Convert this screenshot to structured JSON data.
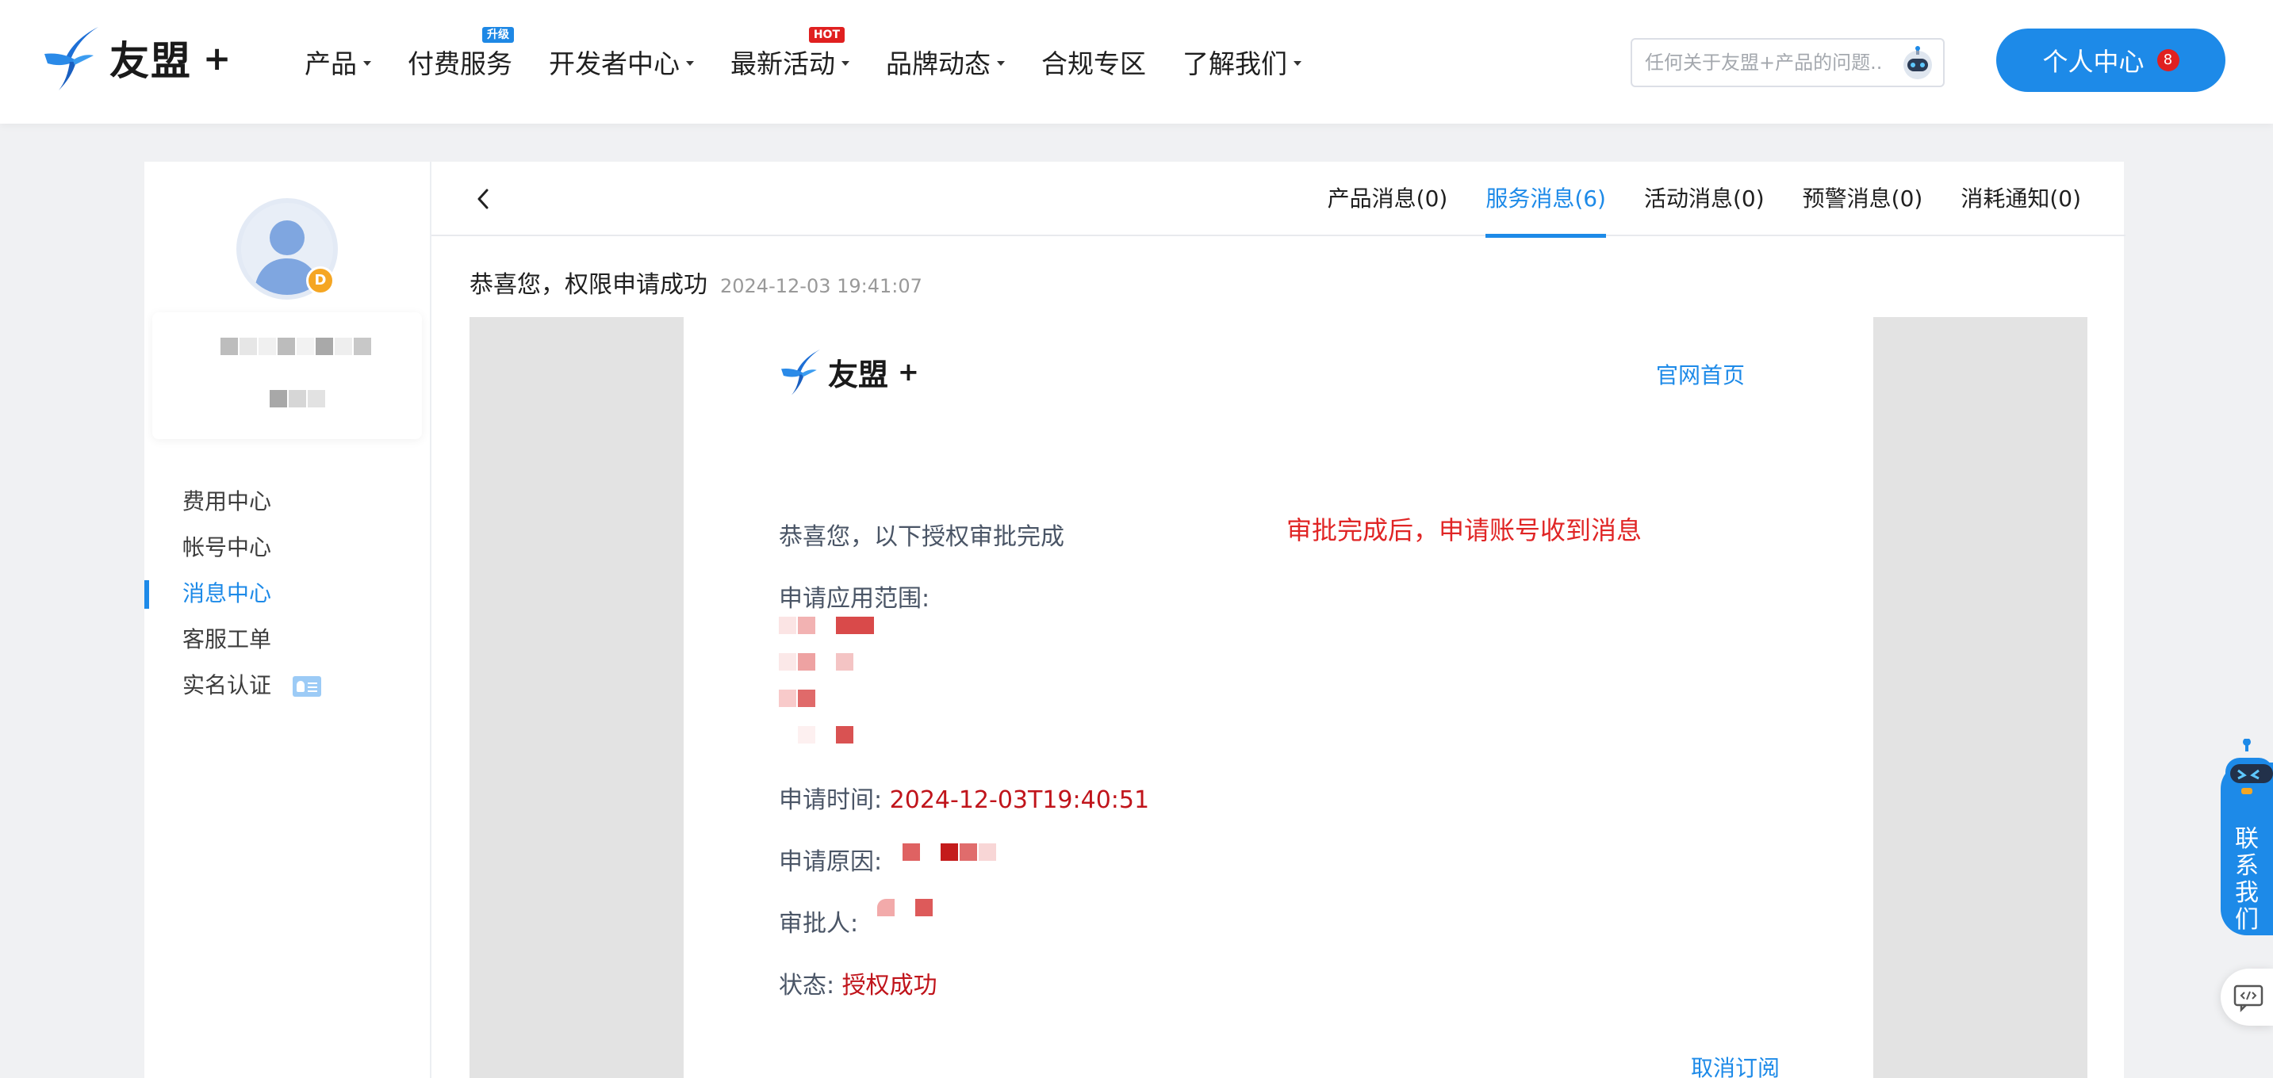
{
  "brand": {
    "name": "友盟",
    "plus": "+"
  },
  "nav": {
    "items": [
      {
        "label": "产品",
        "caret": true,
        "badge": ""
      },
      {
        "label": "付费服务",
        "caret": false,
        "badge": "升级"
      },
      {
        "label": "开发者中心",
        "caret": true,
        "badge": ""
      },
      {
        "label": "最新活动",
        "caret": true,
        "badge": "HOT"
      },
      {
        "label": "品牌动态",
        "caret": true,
        "badge": ""
      },
      {
        "label": "合规专区",
        "caret": false,
        "badge": ""
      },
      {
        "label": "了解我们",
        "caret": true,
        "badge": ""
      }
    ],
    "search_placeholder": "任何关于友盟+产品的问题..",
    "user_center_label": "个人中心",
    "user_center_count": "8"
  },
  "sidebar": {
    "avatar_badge": "D",
    "menu": [
      {
        "label": "费用中心",
        "active": false
      },
      {
        "label": "帐号中心",
        "active": false
      },
      {
        "label": "消息中心",
        "active": true
      },
      {
        "label": "客服工单",
        "active": false
      },
      {
        "label": "实名认证",
        "active": false
      }
    ]
  },
  "main": {
    "tabs": [
      {
        "label": "产品消息(0)",
        "active": false
      },
      {
        "label": "服务消息(6)",
        "active": true
      },
      {
        "label": "活动消息(0)",
        "active": false
      },
      {
        "label": "预警消息(0)",
        "active": false
      },
      {
        "label": "消耗通知(0)",
        "active": false
      }
    ],
    "message_title": "恭喜您，权限申请成功",
    "message_time": "2024-12-03 19:41:07",
    "mail": {
      "home_link": "官网首页",
      "greeting": "恭喜您，以下授权审批完成",
      "annotation": "审批完成后，申请账号收到消息",
      "scope_label": "申请应用范围:",
      "time_label": "申请时间:",
      "time_value": "2024-12-03T19:40:51",
      "reason_label": "申请原因:",
      "approver_label": "审批人:",
      "status_label": "状态:",
      "status_value": "授权成功",
      "unsubscribe": "取消订阅"
    }
  },
  "floating": {
    "contact_label": "联系我们"
  },
  "colors": {
    "accent": "#1d8ae8",
    "highlight_red": "#c0141b",
    "annotation_red": "#e02525"
  }
}
